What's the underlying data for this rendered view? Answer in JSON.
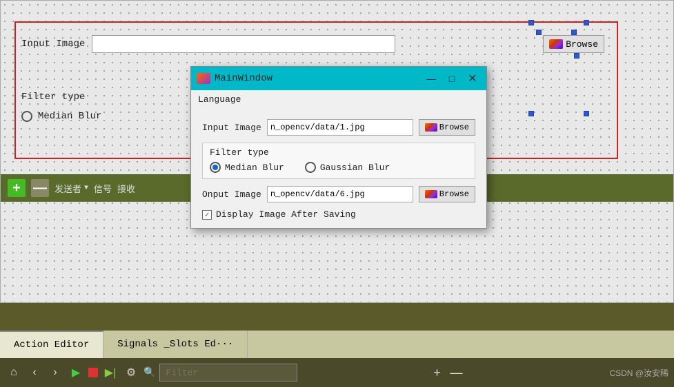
{
  "canvas": {
    "input_image_label": "Input Image",
    "input_image_value": "",
    "browse_label": "Browse",
    "filter_type_label": "Filter type",
    "median_blur_label": "Median Blur"
  },
  "canvas_toolbar": {
    "plus_label": "+",
    "minus_label": "—",
    "sender_label": "发送者",
    "signal_label": "信号",
    "receiver_label": "接收"
  },
  "modal": {
    "title": "MainWindow",
    "menu_language": "Language",
    "input_image_label": "Input Image",
    "input_image_value": "n_opencv/data/1.jpg",
    "input_browse_label": "Browse",
    "filter_type_label": "Filter type",
    "median_blur_label": "Median Blur",
    "gaussian_blur_label": "Gaussian Blur",
    "output_image_label": "Onput Image",
    "output_image_value": "n_opencv/data/6.jpg",
    "output_browse_label": "Browse",
    "display_checkbox_label": "Display Image After Saving",
    "display_checked": true,
    "median_selected": true,
    "gaussian_selected": false,
    "minimize_btn": "—",
    "maximize_btn": "□",
    "close_btn": "✕"
  },
  "tabs": {
    "action_editor": "Action Editor",
    "signals_slots": "Signals _Slots Ed···"
  },
  "bottom_bar": {
    "filter_placeholder": "Filter",
    "plus_label": "+",
    "minus_label": "—",
    "watermark": "CSDN @汝安稀"
  }
}
